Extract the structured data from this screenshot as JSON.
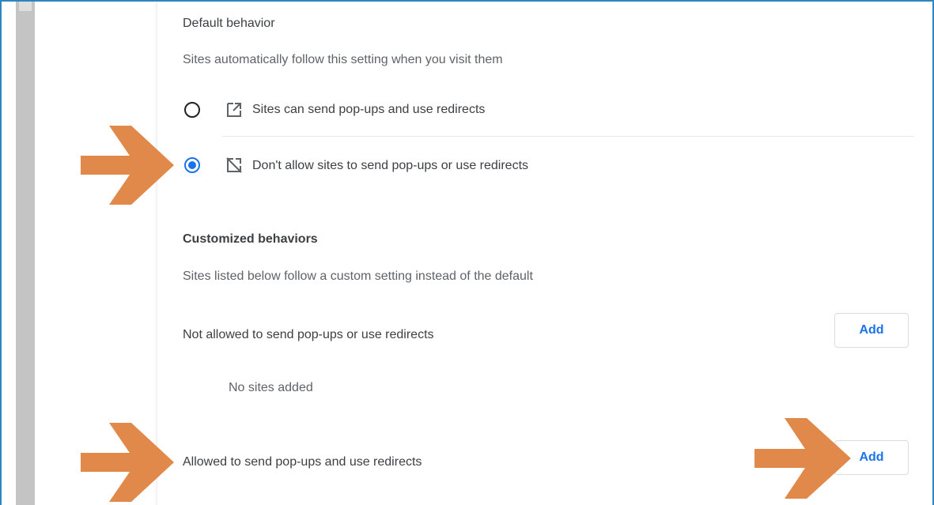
{
  "default_behavior": {
    "heading": "Default behavior",
    "description": "Sites automatically follow this setting when you visit them",
    "options": [
      {
        "label": "Sites can send pop-ups and use redirects",
        "selected": false,
        "icon": "open-in-new-icon"
      },
      {
        "label": "Don't allow sites to send pop-ups or use redirects",
        "selected": true,
        "icon": "popup-blocked-icon"
      }
    ]
  },
  "customized_behaviors": {
    "heading": "Customized behaviors",
    "description": "Sites listed below follow a custom setting instead of the default",
    "not_allowed": {
      "label": "Not allowed to send pop-ups or use redirects",
      "add_label": "Add",
      "empty_text": "No sites added"
    },
    "allowed": {
      "label": "Allowed to send pop-ups and use redirects",
      "add_label": "Add"
    }
  },
  "colors": {
    "accent": "#1a73e8",
    "annotation_arrow": "#e0894a",
    "frame_border": "#2e86c1"
  }
}
